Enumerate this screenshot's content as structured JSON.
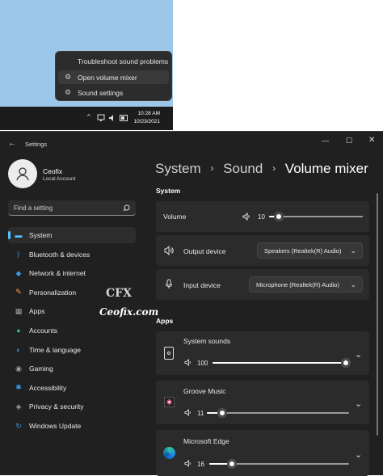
{
  "taskbar_menu": {
    "items": [
      {
        "label": "Troubleshoot sound problems",
        "icon": ""
      },
      {
        "label": "Open volume mixer",
        "icon": "gear-icon"
      },
      {
        "label": "Sound settings",
        "icon": "gear-icon"
      }
    ],
    "time": "10:28 AM",
    "date": "10/23/2021"
  },
  "window": {
    "title": "Settings"
  },
  "user": {
    "name": "Ceofix",
    "account": "Local Account"
  },
  "search": {
    "placeholder": "Find a setting"
  },
  "nav": [
    {
      "label": "System",
      "icon": "display-icon",
      "color": "#4cc2ff",
      "selected": true
    },
    {
      "label": "Bluetooth & devices",
      "icon": "bluetooth-icon",
      "color": "#3a96dd"
    },
    {
      "label": "Network & internet",
      "icon": "wifi-icon",
      "color": "#3a96dd"
    },
    {
      "label": "Personalization",
      "icon": "brush-icon",
      "color": "#f7a350"
    },
    {
      "label": "Apps",
      "icon": "apps-icon",
      "color": "#9aa3ad"
    },
    {
      "label": "Accounts",
      "icon": "person-icon",
      "color": "#2fb574"
    },
    {
      "label": "Time & language",
      "icon": "globe-clock-icon",
      "color": "#3a96dd"
    },
    {
      "label": "Gaming",
      "icon": "gamepad-icon",
      "color": "#9aa3ad"
    },
    {
      "label": "Accessibility",
      "icon": "accessibility-icon",
      "color": "#3a96dd"
    },
    {
      "label": "Privacy & security",
      "icon": "shield-icon",
      "color": "#9aa3ad"
    },
    {
      "label": "Windows Update",
      "icon": "update-icon",
      "color": "#3a96dd"
    }
  ],
  "breadcrumb": {
    "part1": "System",
    "sep": ">",
    "part2": "Sound",
    "current": "Volume mixer"
  },
  "system_section": {
    "heading": "System",
    "volume": {
      "label": "Volume",
      "value": "10",
      "level": 0.1
    },
    "output": {
      "label": "Output device",
      "value": "Speakers (Realtek(R) Audio)"
    },
    "input": {
      "label": "Input device",
      "value": "Microphone (Realtek(R) Audio)"
    }
  },
  "apps_section": {
    "heading": "Apps",
    "apps": [
      {
        "name": "System sounds",
        "volume": "100",
        "level": 1.0,
        "icon": "speaker-device-icon"
      },
      {
        "name": "Groove Music",
        "volume": "11",
        "level": 0.11,
        "icon": "groove-music-icon"
      },
      {
        "name": "Microsoft Edge",
        "volume": "16",
        "level": 0.16,
        "icon": "edge-icon"
      }
    ]
  },
  "watermark": {
    "logo": "CFX",
    "text": "Ceofix.com"
  }
}
